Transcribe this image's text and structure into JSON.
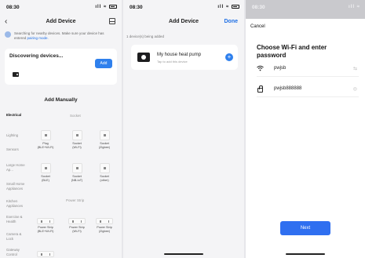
{
  "status_bar": {
    "time": "08:30",
    "icons": "ıll ≈"
  },
  "screen1": {
    "title": "Add Device",
    "hint_text": "Searching for nearby devices. Make sure your device has entered ",
    "hint_link": "pairing mode.",
    "discover_title": "Discovering devices...",
    "add_label": "Add",
    "section_title": "Add Manually",
    "categories": [
      "Electrical",
      "Lighting",
      "Sensors",
      "Large Home Ap...",
      "Small Home Appliances",
      "Kitchen Appliances",
      "Exercise & Health",
      "Camera & Lock",
      "Gateway Control"
    ],
    "group_socket": "Socket",
    "group_strip": "Power Strip",
    "tiles": [
      {
        "label": "Plug\n(BLE+Wi-Fi)"
      },
      {
        "label": "Socket\n(Wi-Fi)"
      },
      {
        "label": "Socket\n(Zigbee)"
      },
      {
        "label": "Socket\n(BLE)"
      },
      {
        "label": "Socket\n(NB-IoT)"
      },
      {
        "label": "Socket\n(other)"
      },
      {
        "label": "Power Strip\n(BLE+Wi-Fi)"
      },
      {
        "label": "Power Strip\n(Wi-Fi)"
      },
      {
        "label": "Power Strip\n(Zigbee)"
      }
    ]
  },
  "screen2": {
    "title": "Add Device",
    "done_label": "Done",
    "subtitle": "1 device(s) being added",
    "device_name": "My house heat pump",
    "device_sub": "Tap to add this device"
  },
  "screen3": {
    "cancel_label": "Cancel",
    "title": "Choose Wi-Fi and enter password",
    "ssid": "pwjsb",
    "password": "pwjsb888888",
    "next_label": "Next"
  }
}
